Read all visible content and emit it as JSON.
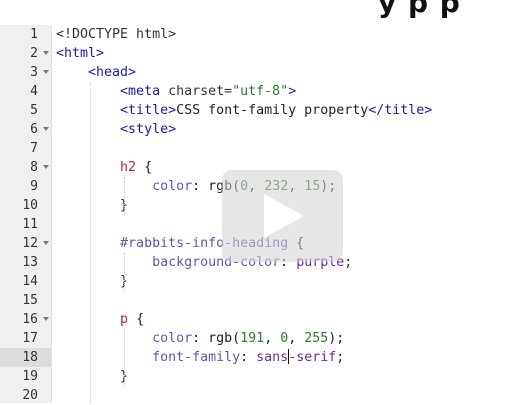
{
  "heading_fragment": "y p p",
  "editor": {
    "active_line": 18,
    "lines": [
      {
        "n": "1",
        "fold": false,
        "tokens": [
          {
            "t": "<!DOCTYPE html>",
            "c": "doctype"
          }
        ]
      },
      {
        "n": "2",
        "fold": true,
        "tokens": [
          {
            "t": "<html>",
            "c": "tag"
          }
        ]
      },
      {
        "n": "3",
        "fold": true,
        "tokens": [
          {
            "t": "    ",
            "c": "plain"
          },
          {
            "t": "<head>",
            "c": "tag"
          }
        ]
      },
      {
        "n": "4",
        "fold": false,
        "tokens": [
          {
            "t": "        ",
            "c": "plain"
          },
          {
            "t": "<meta",
            "c": "tag"
          },
          {
            "t": " charset=",
            "c": "attr"
          },
          {
            "t": "\"utf-8\"",
            "c": "str"
          },
          {
            "t": ">",
            "c": "tag"
          }
        ]
      },
      {
        "n": "5",
        "fold": false,
        "tokens": [
          {
            "t": "        ",
            "c": "plain"
          },
          {
            "t": "<title>",
            "c": "tag"
          },
          {
            "t": "CSS font-family property",
            "c": "text"
          },
          {
            "t": "</title>",
            "c": "tag"
          }
        ]
      },
      {
        "n": "6",
        "fold": true,
        "tokens": [
          {
            "t": "        ",
            "c": "plain"
          },
          {
            "t": "<style>",
            "c": "tag"
          }
        ]
      },
      {
        "n": "7",
        "fold": false,
        "tokens": []
      },
      {
        "n": "8",
        "fold": true,
        "tokens": [
          {
            "t": "        ",
            "c": "plain"
          },
          {
            "t": "h2",
            "c": "selector"
          },
          {
            "t": " {",
            "c": "plain"
          }
        ]
      },
      {
        "n": "9",
        "fold": false,
        "tokens": [
          {
            "t": "            ",
            "c": "plain"
          },
          {
            "t": "color",
            "c": "prop"
          },
          {
            "t": ": ",
            "c": "plain"
          },
          {
            "t": "rgb(",
            "c": "plain"
          },
          {
            "t": "0",
            "c": "num"
          },
          {
            "t": ", ",
            "c": "plain"
          },
          {
            "t": "232",
            "c": "num"
          },
          {
            "t": ", ",
            "c": "plain"
          },
          {
            "t": "15",
            "c": "num"
          },
          {
            "t": ");",
            "c": "plain"
          }
        ]
      },
      {
        "n": "10",
        "fold": false,
        "tokens": [
          {
            "t": "        ",
            "c": "plain"
          },
          {
            "t": "}",
            "c": "plain"
          }
        ]
      },
      {
        "n": "11",
        "fold": false,
        "tokens": []
      },
      {
        "n": "12",
        "fold": true,
        "tokens": [
          {
            "t": "        ",
            "c": "plain"
          },
          {
            "t": "#rabbits-info-heading",
            "c": "id"
          },
          {
            "t": " {",
            "c": "plain"
          }
        ]
      },
      {
        "n": "13",
        "fold": false,
        "tokens": [
          {
            "t": "            ",
            "c": "plain"
          },
          {
            "t": "background-color",
            "c": "prop"
          },
          {
            "t": ": ",
            "c": "plain"
          },
          {
            "t": "purple",
            "c": "val"
          },
          {
            "t": ";",
            "c": "plain"
          }
        ]
      },
      {
        "n": "14",
        "fold": false,
        "tokens": [
          {
            "t": "        ",
            "c": "plain"
          },
          {
            "t": "}",
            "c": "plain"
          }
        ]
      },
      {
        "n": "15",
        "fold": false,
        "tokens": []
      },
      {
        "n": "16",
        "fold": true,
        "tokens": [
          {
            "t": "        ",
            "c": "plain"
          },
          {
            "t": "p",
            "c": "selector"
          },
          {
            "t": " {",
            "c": "plain"
          }
        ]
      },
      {
        "n": "17",
        "fold": false,
        "tokens": [
          {
            "t": "            ",
            "c": "plain"
          },
          {
            "t": "color",
            "c": "prop"
          },
          {
            "t": ": ",
            "c": "plain"
          },
          {
            "t": "rgb(",
            "c": "plain"
          },
          {
            "t": "191",
            "c": "num"
          },
          {
            "t": ", ",
            "c": "plain"
          },
          {
            "t": "0",
            "c": "num"
          },
          {
            "t": ", ",
            "c": "plain"
          },
          {
            "t": "255",
            "c": "num"
          },
          {
            "t": ");",
            "c": "plain"
          }
        ]
      },
      {
        "n": "18",
        "fold": false,
        "tokens": [
          {
            "t": "            ",
            "c": "plain"
          },
          {
            "t": "font-family",
            "c": "prop"
          },
          {
            "t": ": ",
            "c": "plain"
          },
          {
            "t": "sans",
            "c": "val"
          },
          {
            "t": "|",
            "c": "cursor"
          },
          {
            "t": "-serif",
            "c": "val"
          },
          {
            "t": ";",
            "c": "plain"
          }
        ]
      },
      {
        "n": "19",
        "fold": false,
        "tokens": [
          {
            "t": "        ",
            "c": "plain"
          },
          {
            "t": "}",
            "c": "plain"
          }
        ]
      },
      {
        "n": "20",
        "fold": false,
        "tokens": []
      }
    ]
  },
  "play_icon": "play-icon",
  "colors": {
    "gutter": "#f0f0f0",
    "active_line_gutter": "#dcdcdc",
    "tag": "#1a1aa6",
    "string": "#2c7a2c",
    "selector": "#b32d2d",
    "property": "#5a5ab0",
    "value": "#6a2c9a"
  }
}
